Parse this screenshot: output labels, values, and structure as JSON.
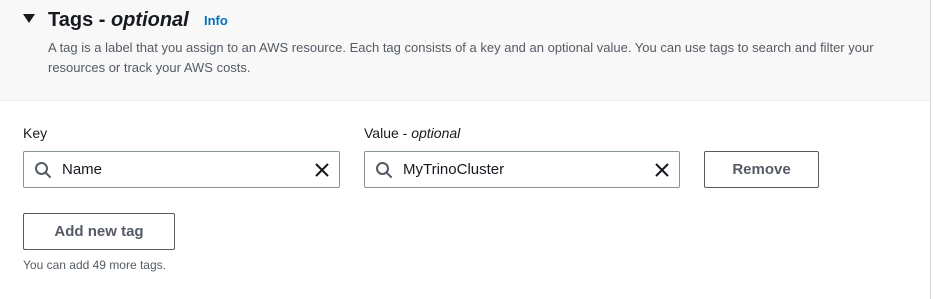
{
  "section": {
    "title": "Tags - ",
    "title_optional": "optional",
    "info_link": "Info",
    "description": "A tag is a label that you assign to an AWS resource. Each tag consists of a key and an optional value. You can use tags to search and filter your resources or track your AWS costs."
  },
  "tag_row": {
    "key_label": "Key",
    "value_label": "Value - ",
    "value_label_optional": "optional",
    "key_value": "Name",
    "value_value": "MyTrinoCluster",
    "remove_label": "Remove"
  },
  "add_tag_label": "Add new tag",
  "remaining_hint": "You can add 49 more tags.",
  "icons": {
    "expand": "caret-down-icon",
    "search": "search-icon",
    "clear": "close-icon"
  },
  "colors": {
    "link": "#0073bb",
    "header_bg": "#f8f8f8",
    "border": "#879596",
    "button_text": "#545b64"
  }
}
